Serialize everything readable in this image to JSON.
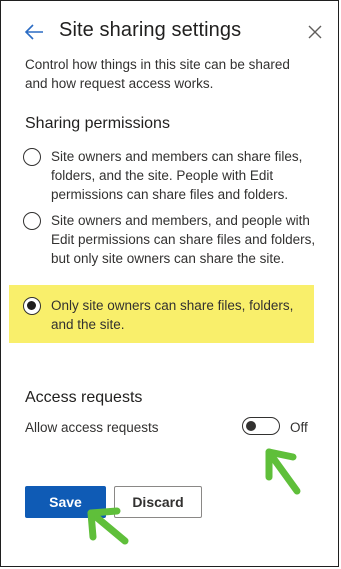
{
  "header": {
    "title": "Site sharing settings",
    "back_icon": "back-arrow-icon",
    "close_icon": "close-icon"
  },
  "description": "Control how things in this site can be shared and how request access works.",
  "sharing": {
    "heading": "Sharing permissions",
    "options": [
      {
        "label": "Site owners and members can share files, folders, and the site. People with Edit permissions can share files and folders.",
        "checked": false
      },
      {
        "label": "Site owners and members, and people with Edit permissions can share files and folders, but only site owners can share the site.",
        "checked": false
      },
      {
        "label": "Only site owners can share files, folders, and the site.",
        "checked": true
      }
    ],
    "highlight_color": "#f9ef6b"
  },
  "access": {
    "heading": "Access requests",
    "toggle_label": "Allow access requests",
    "toggle_state": "Off",
    "toggle_on": false
  },
  "actions": {
    "save_label": "Save",
    "discard_label": "Discard",
    "primary_color": "#0f5bb5"
  },
  "annotations": {
    "arrow_color": "#5fbf3a",
    "arrow_icon": "pointer-arrow-icon"
  }
}
